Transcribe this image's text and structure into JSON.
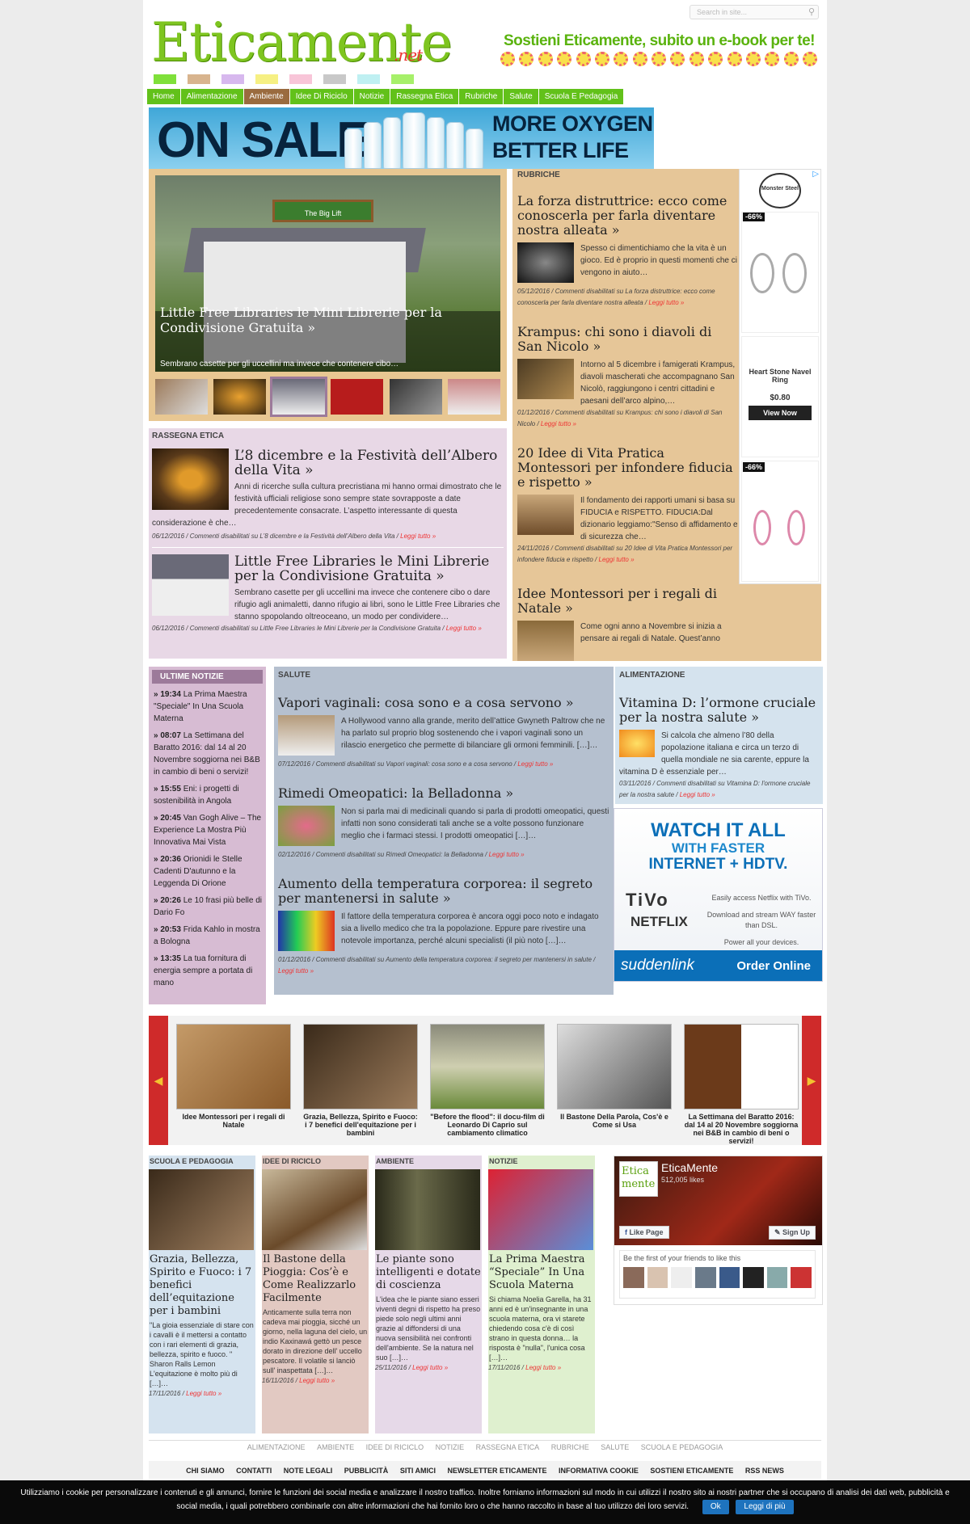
{
  "header": {
    "logo_text": "Eticamente",
    "logo_suffix": ".net",
    "search_placeholder": "Search in site...",
    "promo": "Sostieni Eticamente, subito un e-book per te!"
  },
  "colors": {
    "accent": "#62c11a",
    "brand_red": "#e33333",
    "active_nav": "#9a6b3f"
  },
  "nav": [
    {
      "label": "Home"
    },
    {
      "label": "Alimentazione"
    },
    {
      "label": "Ambiente",
      "active": true
    },
    {
      "label": "Idee Di Riciclo"
    },
    {
      "label": "Notizie"
    },
    {
      "label": "Rassegna Etica"
    },
    {
      "label": "Rubriche"
    },
    {
      "label": "Salute"
    },
    {
      "label": "Scuola E Pedagogia"
    }
  ],
  "banner": {
    "left": "ON SALE",
    "right_line1": "MORE OXYGEN",
    "right_line2": "BETTER LIFE"
  },
  "slider": {
    "sign": "The Big Lift",
    "title": "Little Free Libraries le Mini Librerie per la Condivisione Gratuita »",
    "subtitle": "Sembrano casette per gli uccellini ma invece che contenere cibo…"
  },
  "rubriche": {
    "label": "RUBRICHE",
    "articles": [
      {
        "title": "La forza distruttrice: ecco come conoscerla per farla diventare nostra alleata »",
        "text": "Spesso ci dimentichiamo che la vita è un gioco. Ed è proprio in questi momenti che ci vengono in aiuto…",
        "meta": "05/12/2016 / Commenti disabilitati su La forza distruttrice: ecco come conoscerla per farla diventare nostra alleata / ",
        "more": "Leggi tutto »"
      },
      {
        "title": "Krampus: chi sono i diavoli di San Nicolo »",
        "text": "Intorno al 5 dicembre i famigerati Krampus, diavoli mascherati che accompagnano San Nicolò, raggiungono i centri cittadini e paesani dell’arco alpino,…",
        "meta": "01/12/2016 / Commenti disabilitati su Krampus: chi sono i diavoli di San Nicolo / ",
        "more": "Leggi tutto »"
      },
      {
        "title": "20 Idee di Vita Pratica Montessori per infondere fiducia e rispetto »",
        "text": "Il fondamento dei rapporti umani si basa su FIDUCIA e RISPETTO. FIDUCIA:Dal dizionario leggiamo:\"Senso di affidamento e di sicurezza che…",
        "meta": "24/11/2016 / Commenti disabilitati su 20 Idee di Vita Pratica Montessori per infondere fiducia e rispetto / ",
        "more": "Leggi tutto »"
      },
      {
        "title": "Idee Montessori per i regali di Natale »",
        "text": "Come ogni anno a Novembre si inizia a pensare ai regali di Natale. Quest’anno",
        "meta": "",
        "more": ""
      }
    ]
  },
  "ads": {
    "brand": "Monster Steel",
    "badge1": "-66%",
    "item2_title": "Heart Stone Navel Ring",
    "item2_price": "$0.80",
    "item2_button": "View Now",
    "badge3": "-66%"
  },
  "rassegna": {
    "label": "RASSEGNA ETICA",
    "articles": [
      {
        "title": "L’8 dicembre e la Festività dell’Albero della Vita »",
        "text": "Anni di ricerche sulla cultura precristiana mi hanno ormai dimostrato che le festività ufficiali religiose sono sempre state sovrapposte a date precedentemente consacrate. L’aspetto interessante di questa considerazione è che…",
        "meta": "06/12/2016 / Commenti disabilitati su L’8 dicembre e la Festività dell’Albero della Vita / ",
        "more": "Leggi tutto »"
      },
      {
        "title": "Little Free Libraries le Mini Librerie per la Condivisione Gratuita »",
        "text": "Sembrano casette per gli uccellini ma invece che contenere cibo o dare rifugio agli animaletti, danno rifugio ai libri, sono le Little Free Libraries che stanno spopolando oltreoceano, un modo per condividere…",
        "meta": "06/12/2016 / Commenti disabilitati su Little Free Libraries le Mini Librerie per la Condivisione Gratuita / ",
        "more": "Leggi tutto »"
      }
    ]
  },
  "ultime": {
    "title": "ULTIME NOTIZIE",
    "items": [
      {
        "time": "» 19:34",
        "text": "La Prima Maestra \"Speciale\" In Una Scuola Materna"
      },
      {
        "time": "» 08:07",
        "text": "La Settimana del Baratto 2016: dal 14 al 20 Novembre soggiorna nei B&B in cambio di beni o servizi!"
      },
      {
        "time": "» 15:55",
        "text": "Eni: i progetti di sostenibilità in Angola"
      },
      {
        "time": "» 20:45",
        "text": "Van Gogh Alive – The Experience La Mostra Più Innovativa Mai Vista"
      },
      {
        "time": "» 20:36",
        "text": "Orionidi le Stelle Cadenti D'autunno e la Leggenda Di Orione"
      },
      {
        "time": "» 20:26",
        "text": "Le 10 frasi più belle di Dario Fo"
      },
      {
        "time": "» 20:53",
        "text": "Frida Kahlo in mostra a Bologna"
      },
      {
        "time": "» 13:35",
        "text": "La tua fornitura di energia sempre a portata di mano"
      }
    ]
  },
  "salute": {
    "label": "SALUTE",
    "articles": [
      {
        "title": "Vapori vaginali: cosa sono e a cosa servono »",
        "text": "A Hollywood vanno alla grande, merito dell’attice Gwyneth Paltrow che ne ha parlato sul proprio blog sostenendo che i vapori vaginali sono un rilascio energetico che permette di bilanciare gli ormoni femminili. […]…",
        "meta": "07/12/2016 / Commenti disabilitati su Vapori vaginali: cosa sono e a cosa servono / ",
        "more": "Leggi tutto »"
      },
      {
        "title": "Rimedi Omeopatici: la Belladonna »",
        "text": "Non si parla mai di medicinali quando si parla di prodotti omeopatici, questi infatti non sono considerati tali anche se a volte possono funzionare meglio che i farmaci stessi. I prodotti omeopatici […]…",
        "meta": "02/12/2016 / Commenti disabilitati su Rimedi Omeopatici: la Belladonna / ",
        "more": "Leggi tutto »"
      },
      {
        "title": "Aumento della temperatura corporea: il segreto per mantenersi in salute »",
        "text": "Il fattore della temperatura corporea è ancora oggi poco noto e indagato sia a livello medico che tra la popolazione. Eppure pare rivestire una notevole importanza, perché alcuni specialisti (il più noto […]…",
        "meta": "01/12/2016 / Commenti disabilitati su Aumento della temperatura corporea: il segreto per mantenersi in salute / ",
        "more": "Leggi tutto »"
      }
    ]
  },
  "alimentazione": {
    "label": "ALIMENTAZIONE",
    "title": "Vitamina D: l’ormone cruciale per la nostra salute »",
    "text": "Si calcola che almeno l’80 della popolazione italiana e circa un terzo di quella mondiale ne sia carente, eppure la vitamina D è essenziale per…",
    "meta": "03/11/2016 / Commenti disabilitati su Vitamina D: l'ormone cruciale per la nostra salute / ",
    "more": "Leggi tutto »"
  },
  "tivo_ad": {
    "line1": "WATCH IT ALL",
    "line2": "WITH FASTER",
    "line3": "INTERNET + HDTV.",
    "brand1": "TiVo",
    "brand2": "NETFLIX",
    "t1": "Easily access Netflix with TiVo.",
    "t2": "Download and stream WAY faster than DSL.",
    "t3": "Power all your devices.",
    "footer_brand": "suddenlink",
    "footer_cta": "Order Online"
  },
  "carousel": [
    {
      "caption": "Idee Montessori per i regali di Natale"
    },
    {
      "caption": "Grazia, Bellezza, Spirito e Fuoco: i 7 benefici dell'equitazione per i bambini"
    },
    {
      "caption": "\"Before the flood\": il docu-film di Leonardo Di Caprio sul cambiamento climatico"
    },
    {
      "caption": "Il Bastone Della Parola, Cos'è e Come si Usa"
    },
    {
      "caption": "La Settimana del Baratto 2016: dal 14 al 20 Novembre soggiorna nei B&B in cambio di beni o servizi!"
    }
  ],
  "bottom": [
    {
      "label": "SCUOLA E PEDAGOGIA",
      "title": "Grazia, Bellezza, Spirito e Fuoco: i 7 benefici dell’equitazione per i bambini",
      "text": "\"La gioia essenziale di stare con i cavalli è il mettersi a contatto con i rari elementi di grazia, bellezza, spirito e fuoco. \" Sharon Ralls Lemon L'equitazione è molto più di […]…",
      "date": "17/11/2016 / ",
      "more": "Leggi tutto »"
    },
    {
      "label": "IDEE DI RICICLO",
      "title": "Il Bastone della Pioggia: Cos’è e Come Realizzarlo Facilmente",
      "text": "Anticamente sulla terra non cadeva mai pioggia, sicché un giorno, nella laguna del cielo, un indio Kaxinawá gettò un pesce dorato in direzione dell' uccello pescatore. Il volatile si lanciò sull' inaspettata […]…",
      "date": "16/11/2016 / ",
      "more": "Leggi tutto »"
    },
    {
      "label": "AMBIENTE",
      "title": "Le piante sono intelligenti e dotate di coscienza",
      "text": "L'idea che le piante siano esseri viventi degni di rispetto ha preso piede solo negli ultimi anni grazie al diffondersi di una nuova sensibilità nei confronti dell'ambiente. Se la natura nel suo […]…",
      "date": "25/11/2016 / ",
      "more": "Leggi tutto »"
    },
    {
      "label": "NOTIZIE",
      "title": "La Prima Maestra “Speciale” In Una Scuola Materna",
      "text": "Si chiama Noelia Garella, ha 31 anni ed è un'insegnante in una scuola materna, ora vi starete chiedendo cosa c'è di così strano in questa donna… la risposta è \"nulla\", l'unica cosa […]…",
      "date": "17/11/2016 / ",
      "more": "Leggi tutto »"
    }
  ],
  "facebook": {
    "name": "EticaMente",
    "likes": "512,005 likes",
    "like_btn": "Like Page",
    "signup_btn": "Sign Up",
    "friends": "Be the first of your friends to like this",
    "logo_l1": "Etica",
    "logo_l2": "mente"
  },
  "footer_nav1": [
    "ALIMENTAZIONE",
    "AMBIENTE",
    "IDEE DI RICICLO",
    "NOTIZIE",
    "RASSEGNA ETICA",
    "RUBRICHE",
    "SALUTE",
    "SCUOLA E PEDAGOGIA"
  ],
  "footer_nav2": [
    "CHI SIAMO",
    "CONTATTI",
    "NOTE LEGALI",
    "PUBBLICITÀ",
    "SITI AMICI",
    "NEWSLETTER ETICAMENTE",
    "INFORMATIVA COOKIE",
    "SOSTIENI ETICAMENTE",
    "RSS NEWS"
  ],
  "cookie": {
    "text1": "Utilizziamo i cookie per personalizzare i contenuti e gli annunci, fornire le funzioni dei social media e analizzare il nostro traffico. Inoltre forniamo informazioni sul modo in cui utilizzi il nostro sito ai nostri partner che si occupano di analisi dei dati web, pubblicità e",
    "text2": "social media, i quali potrebbero combinarle con altre informazioni che hai fornito loro o che hanno raccolto in base al tuo utilizzo dei loro servizi.",
    "ok": "Ok",
    "more": "Leggi di più"
  }
}
